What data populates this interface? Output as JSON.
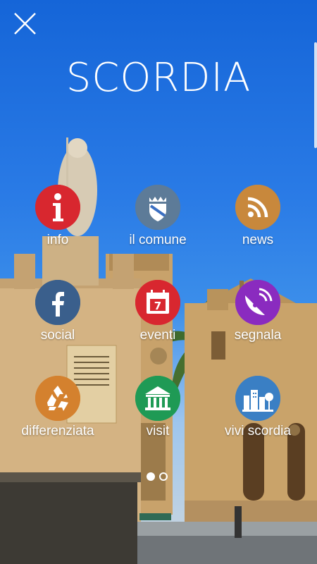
{
  "header": {
    "title": "SCORDIA",
    "close_icon": "close-icon"
  },
  "menu": {
    "items": [
      {
        "id": "info",
        "label": "info",
        "icon": "info-icon",
        "color": "#d8272f"
      },
      {
        "id": "comune",
        "label": "il comune",
        "icon": "town-crest-icon",
        "color": "#5d7b98"
      },
      {
        "id": "news",
        "label": "news",
        "icon": "rss-icon",
        "color": "#c8883c"
      },
      {
        "id": "social",
        "label": "social",
        "icon": "facebook-icon",
        "color": "#3a5f8c"
      },
      {
        "id": "eventi",
        "label": "eventi",
        "icon": "calendar-icon",
        "color": "#d8272f"
      },
      {
        "id": "segnala",
        "label": "segnala",
        "icon": "satellite-icon",
        "color": "#8a2bbf"
      },
      {
        "id": "differenziata",
        "label": "differenziata",
        "icon": "recycle-icon",
        "color": "#d4812e"
      },
      {
        "id": "visit",
        "label": "visit",
        "icon": "museum-icon",
        "color": "#1f9a55"
      },
      {
        "id": "vivi",
        "label": "vivi scordia",
        "icon": "city-icon",
        "color": "#3a7fc4"
      }
    ],
    "calendar_day": "7"
  },
  "pager": {
    "pages": 2,
    "current": 1
  }
}
